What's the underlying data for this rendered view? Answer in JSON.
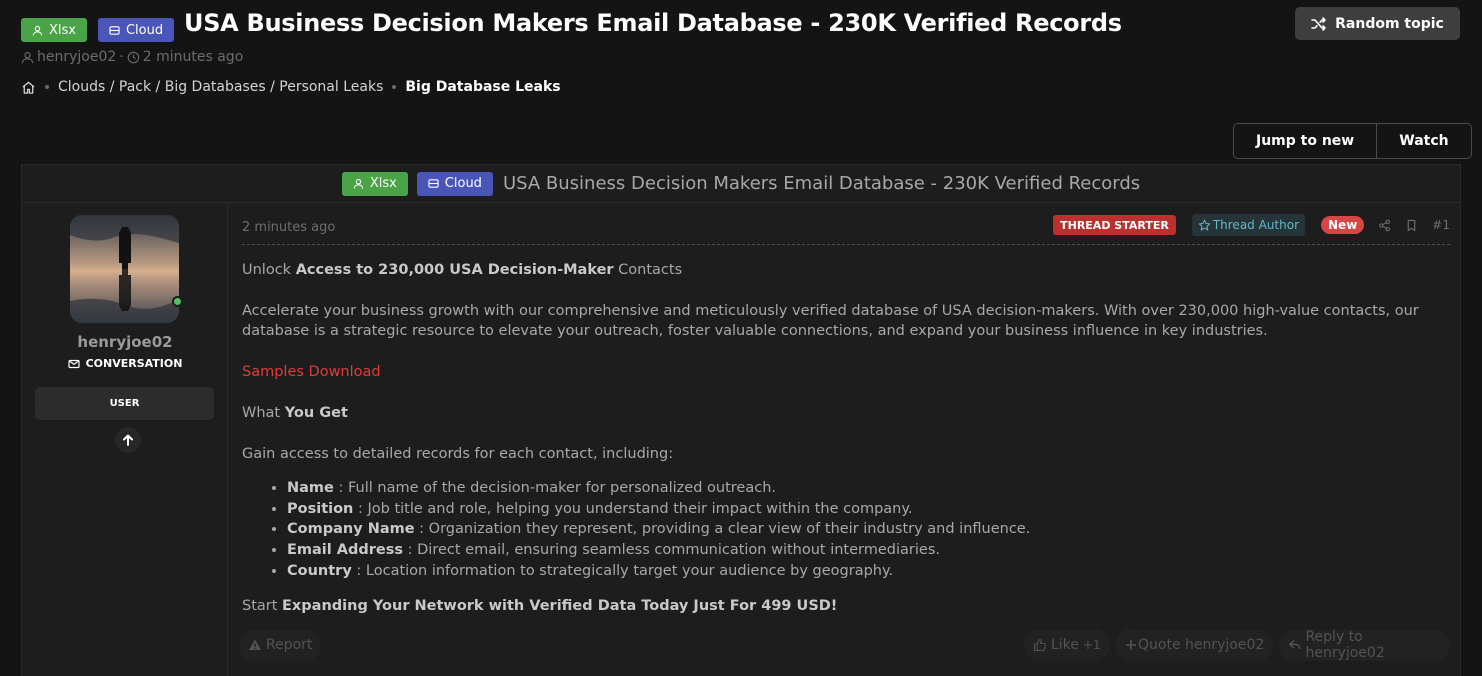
{
  "header": {
    "badge_xlsx": "Xlsx",
    "badge_cloud": "Cloud",
    "title": "USA Business Decision Makers Email Database - 230K Verified Records",
    "author": "henryjoe02",
    "meta_sep": "·",
    "time": "2 minutes ago",
    "random_topic": "Random topic"
  },
  "breadcrumb": {
    "items": [
      "Clouds / Pack / Big Databases / Personal Leaks",
      "Big Database Leaks"
    ]
  },
  "actions": {
    "jump": "Jump to new",
    "watch": "Watch"
  },
  "thread": {
    "badge_xlsx": "Xlsx",
    "badge_cloud": "Cloud",
    "title": "USA Business Decision Makers Email Database - 230K Verified Records"
  },
  "user": {
    "name": "henryjoe02",
    "conversation": "CONVERSATION",
    "role": "USER"
  },
  "post": {
    "time": "2 minutes ago",
    "starter": "THREAD STARTER",
    "author_badge": "Thread Author",
    "new_badge": "New",
    "number": "#1",
    "intro_pre": "Unlock ",
    "intro_bold": "Access to 230,000 USA Decision-Maker",
    "intro_post": " Contacts",
    "desc_line1": "Accelerate your business growth with our comprehensive and meticulously verified database of USA decision-makers. With over 230,000 high-value contacts, our",
    "desc_line2": "database is a strategic resource to elevate your outreach, foster valuable connections, and expand your business influence in key industries.",
    "samples": "Samples Download",
    "what_pre": "What ",
    "what_bold": "You Get",
    "gain": "Gain access to detailed records for each contact, including:",
    "fields": [
      {
        "name": "Name",
        "desc": " : Full name of the decision-maker for personalized outreach."
      },
      {
        "name": "Position",
        "desc": " : Job title and role, helping you understand their impact within the company."
      },
      {
        "name": "Company Name",
        "desc": " : Organization they represent, providing a clear view of their industry and influence."
      },
      {
        "name": "Email Address",
        "desc": " : Direct email, ensuring seamless communication without intermediaries."
      },
      {
        "name": "Country",
        "desc": " : Location information to strategically target your audience by geography."
      }
    ],
    "start_pre": "Start ",
    "start_bold": "Expanding Your Network with Verified Data Today Just For 499 USD!"
  },
  "footer": {
    "report": "Report",
    "like": "Like",
    "like_count": "+1",
    "quote": "Quote henryjoe02",
    "reply": "Reply to henryjoe02"
  },
  "colors": {
    "background": "#141414",
    "panel": "#1d1d1d",
    "badge_green": "#4aa347",
    "badge_blue": "#4a55b8",
    "starter_red": "#bd3030",
    "link_red": "#e23b3b",
    "online_green": "#54c063"
  }
}
